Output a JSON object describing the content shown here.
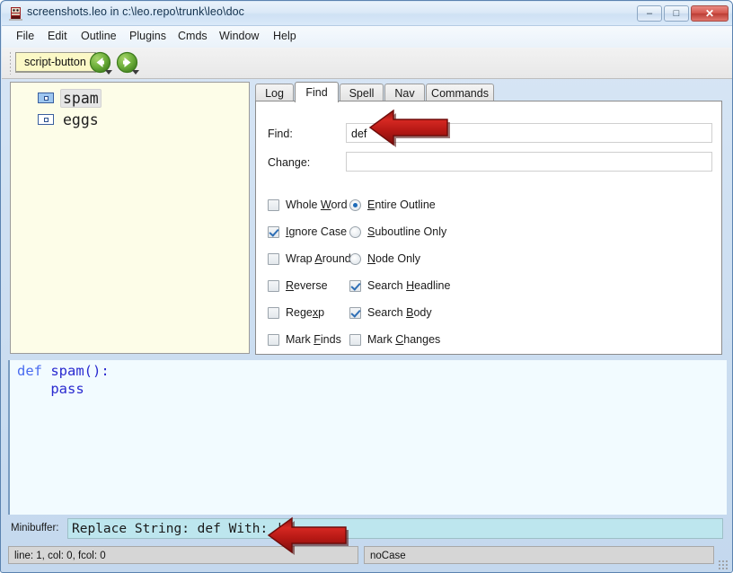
{
  "window": {
    "title": "screenshots.leo in c:\\leo.repo\\trunk\\leo\\doc",
    "app_icon": "leo-app-icon",
    "controls": {
      "minimize": "–",
      "maximize": "□",
      "close": "✕"
    }
  },
  "menubar": {
    "items": [
      {
        "label": "File"
      },
      {
        "label": "Edit"
      },
      {
        "label": "Outline"
      },
      {
        "label": "Plugins"
      },
      {
        "label": "Cmds"
      },
      {
        "label": "Window"
      },
      {
        "label": "Help"
      }
    ]
  },
  "toolbar": {
    "script_button": "script-button",
    "back_icon": "green-left-arrow-icon",
    "forward_icon": "green-right-arrow-icon"
  },
  "outline": {
    "nodes": [
      {
        "label": "spam",
        "selected": true
      },
      {
        "label": "eggs",
        "selected": false
      }
    ]
  },
  "log_pane": {
    "tabs": [
      {
        "label": "Log",
        "active": false
      },
      {
        "label": "Find",
        "active": true
      },
      {
        "label": "Spell",
        "active": false
      },
      {
        "label": "Nav",
        "active": false
      },
      {
        "label": "Commands",
        "active": false
      }
    ]
  },
  "find_panel": {
    "find_label": "Find:",
    "find_value": "def",
    "change_label": "Change:",
    "change_value": "",
    "left_options": [
      {
        "label_pre": "Whole ",
        "label_key": "W",
        "label_post": "ord",
        "checked": false
      },
      {
        "label_pre": "",
        "label_key": "I",
        "label_post": "gnore Case",
        "checked": true
      },
      {
        "label_pre": "Wrap ",
        "label_key": "A",
        "label_post": "round",
        "checked": false
      },
      {
        "label_pre": "",
        "label_key": "R",
        "label_post": "everse",
        "checked": false
      },
      {
        "label_pre": "Rege",
        "label_key": "x",
        "label_post": "p",
        "checked": false
      },
      {
        "label_pre": "Mark ",
        "label_key": "F",
        "label_post": "inds",
        "checked": false
      }
    ],
    "right_options": [
      {
        "type": "radio",
        "label_pre": "",
        "label_key": "E",
        "label_post": "ntire Outline",
        "checked": true
      },
      {
        "type": "radio",
        "label_pre": "",
        "label_key": "S",
        "label_post": "uboutline Only",
        "checked": false
      },
      {
        "type": "radio",
        "label_pre": "",
        "label_key": "N",
        "label_post": "ode Only",
        "checked": false
      },
      {
        "type": "check",
        "label_pre": "Search ",
        "label_key": "H",
        "label_post": "eadline",
        "checked": true
      },
      {
        "type": "check",
        "label_pre": "Search ",
        "label_key": "B",
        "label_post": "ody",
        "checked": true
      },
      {
        "type": "check",
        "label_pre": "Mark ",
        "label_key": "C",
        "label_post": "hanges",
        "checked": false
      }
    ]
  },
  "body": {
    "line1_keyword": "def",
    "line1_rest": " spam():",
    "line2": "    pass"
  },
  "minibuffer": {
    "label": "Minibuffer:",
    "value": "Replace String: def With: |"
  },
  "statusbar": {
    "left": "line: 1, col: 0, fcol: 0",
    "right": "noCase"
  },
  "annotations": {
    "find_arrow": "red-left-arrow-annotation",
    "minibuffer_arrow": "red-left-arrow-annotation"
  },
  "colors": {
    "tree_bg": "#fdfde8",
    "body_bg": "#f2fbff",
    "minibuffer_bg": "#bde6ee",
    "accent_blue": "#1e6bb8",
    "annotation_red": "#c4141b"
  }
}
